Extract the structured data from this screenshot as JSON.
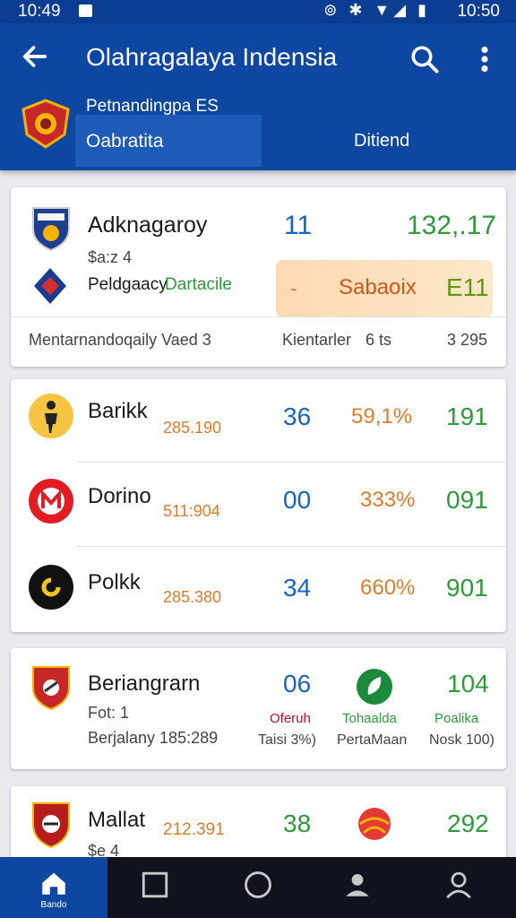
{
  "status_bar": {
    "time_left": "10:49",
    "time_right": "10:50"
  },
  "app_bar": {
    "title": "Olahragalaya Indensia",
    "tab_subtitle": "Petnandingpa ES",
    "tab_active": "Oabratita",
    "tab_second": "Ditiend"
  },
  "card1": {
    "team": "Adknagaroy",
    "sub": "$a:z 4",
    "score": "11",
    "value": "132,.17",
    "partner": "Peldgaacy",
    "partner_tag": "Dartacile",
    "badge_dash": "-",
    "badge_text": "Sabaoix",
    "badge_value": "E11",
    "footer_left": "Mentarnandoqaily Vaed 3",
    "footer_mid": "Kientarler",
    "footer_mid_num": "6 ts",
    "footer_right": "3 295"
  },
  "card2": {
    "rows": [
      {
        "name": "Barikk",
        "sub": "285.190",
        "score": "36",
        "pct": "59,1%",
        "value": "191"
      },
      {
        "name": "Dorino",
        "sub": "511:904",
        "score": "00",
        "pct": "333%",
        "value": "091"
      },
      {
        "name": "Polkk",
        "sub": "285.380",
        "score": "34",
        "pct": "660%",
        "value": "901"
      }
    ]
  },
  "card3": {
    "team": "Beriangrarn",
    "sub": "Fot: 1",
    "detail": "Berjalany 185:289",
    "score": "06",
    "score_label": "Oferuh",
    "score_sub": "Taisi 3%)",
    "mid_label": "Tohaalda",
    "mid_sub": "PertaMaan",
    "value": "104",
    "value_label": "Poalika",
    "value_sub": "Nosk 100)"
  },
  "card4": {
    "team": "Mallat",
    "sub": "$e 4",
    "ratio": "212.391",
    "score": "38",
    "value": "292"
  },
  "nav": {
    "home_label": "Bando"
  },
  "colors": {
    "primary": "#0d47a1",
    "blue": "#1565c0",
    "green": "#2e9a3a",
    "orange": "#e07b2a",
    "nav_bg": "#10131d"
  }
}
